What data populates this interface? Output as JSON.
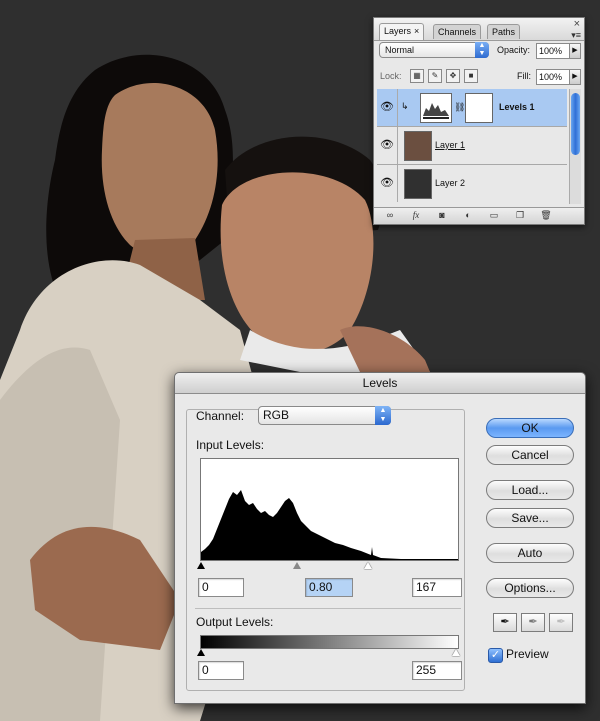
{
  "layers_panel": {
    "tabs": [
      {
        "label": "Layers",
        "close": "×"
      },
      {
        "label": "Channels"
      },
      {
        "label": "Paths"
      }
    ],
    "close_glyph": "×",
    "blend_mode": "Normal",
    "opacity_label": "Opacity:",
    "opacity_value": "100%",
    "lock_label": "Lock:",
    "fill_label": "Fill:",
    "fill_value": "100%",
    "layers": [
      {
        "name": "Levels 1",
        "selected": true,
        "visible": true
      },
      {
        "name": "Layer 1",
        "selected": false,
        "visible": true
      },
      {
        "name": "Layer 2",
        "selected": false,
        "visible": true
      }
    ],
    "bottom_icons": [
      "link-icon",
      "fx-icon",
      "mask-icon",
      "adjustment-icon",
      "group-icon",
      "new-layer-icon",
      "trash-icon"
    ],
    "fx_label": "fx"
  },
  "levels_dialog": {
    "title": "Levels",
    "channel_label": "Channel:",
    "channel_value": "RGB",
    "input_levels_label": "Input Levels:",
    "input_black": "0",
    "input_gamma": "0.80",
    "input_white": "167",
    "output_levels_label": "Output Levels:",
    "output_black": "0",
    "output_white": "255",
    "buttons": {
      "ok": "OK",
      "cancel": "Cancel",
      "load": "Load...",
      "save": "Save...",
      "auto": "Auto",
      "options": "Options..."
    },
    "preview_label": "Preview",
    "preview_checked": true,
    "check_glyph": "✓"
  },
  "colors": {
    "background": "#2f2f2f",
    "selection": "#a9c9f2",
    "accent_blue": "#2e6fd3"
  }
}
